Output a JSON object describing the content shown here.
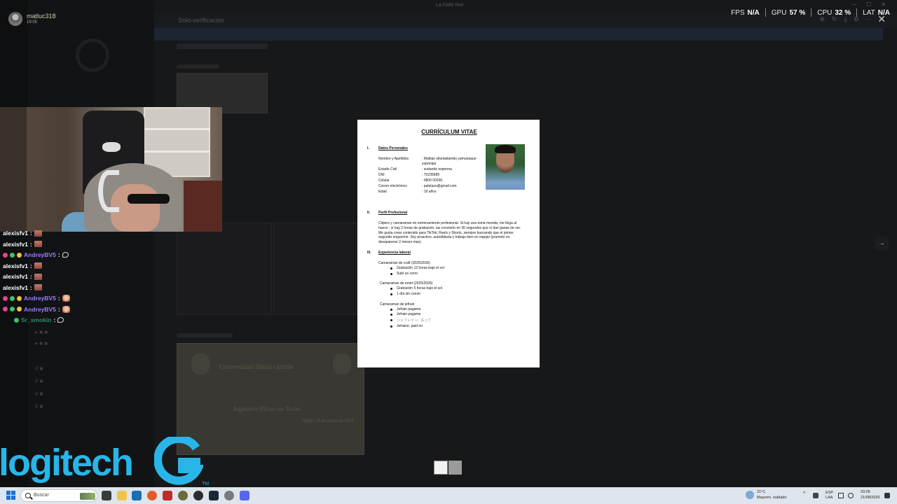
{
  "overlay": {
    "username": "matluc318",
    "stream_time": "19:05",
    "window_title": "La Dalle free",
    "stats": [
      {
        "label": "FPS",
        "value": "N/A"
      },
      {
        "label": "GPU",
        "value": "57 %"
      },
      {
        "label": "CPU",
        "value": "32 %"
      },
      {
        "label": "LAT",
        "value": "N/A"
      }
    ],
    "close_glyph": "✕",
    "next_glyph": "→"
  },
  "background": {
    "channel_title": "Solo-verificacion",
    "certificate_title": "Universidad illeral carrión",
    "certificate_subtitle": "Ingeniero Hiloso en Trolio",
    "certificate_date": "Negro 24 de Mayo de 2025"
  },
  "chat": {
    "messages": [
      {
        "user": "alexisfv1",
        "color": "#ffffff",
        "badges": [],
        "emote": "pepe"
      },
      {
        "user": "alexisfv1",
        "color": "#ffffff",
        "badges": [],
        "emote": "pepe"
      },
      {
        "user": "AndreyBV5",
        "color": "#9a7cff",
        "badges": [
          "#e0468a",
          "#3fbf6b",
          "#f0c040"
        ],
        "emote": "bubble"
      },
      {
        "user": "alexisfv1",
        "color": "#ffffff",
        "badges": [],
        "emote": "pepe"
      },
      {
        "user": "alexisfv1",
        "color": "#ffffff",
        "badges": [],
        "emote": "pepe"
      },
      {
        "user": "alexisfv1",
        "color": "#ffffff",
        "badges": [],
        "emote": "pepe"
      },
      {
        "user": "AndreyBV5",
        "color": "#9a7cff",
        "badges": [
          "#e0468a",
          "#3fbf6b",
          "#f0c040"
        ],
        "emote": "face"
      },
      {
        "user": "AndreyBV5",
        "color": "#9a7cff",
        "badges": [
          "#e0468a",
          "#3fbf6b",
          "#f0c040"
        ],
        "emote": "face"
      },
      {
        "user": "Sr_smokin",
        "color": "#2f8a6f",
        "badges": [
          "#3fbf6b"
        ],
        "emote": "bubble"
      }
    ]
  },
  "logo": {
    "text": "logitech",
    "tm": "TM"
  },
  "document": {
    "title": "CURRÍCULUM VITAE",
    "sections": [
      {
        "num": "I.",
        "title": "Datos Personales"
      },
      {
        "num": "II.",
        "title": "Perfil Profesional"
      },
      {
        "num": "III.",
        "title": "Experiencia laboral"
      }
    ],
    "personal": [
      {
        "key": "Nombre y Apellidos",
        "value": ": Mattias ollantaitambo yamunaque"
      },
      {
        "key": "",
        "value": "  yupanqui"
      },
      {
        "key": "Estado Civil",
        "value": ": sudando esperma"
      },
      {
        "key": "DNI",
        "value": ": 70235689"
      },
      {
        "key": "Celular",
        "value": ": 0800 00200."
      },
      {
        "key": "Correo electrónico",
        "value": ": paletazo@gmail.com"
      },
      {
        "key": "Edad",
        "value": ": 19 años"
      }
    ],
    "profile_text": "Clipero y camaraman en entrenamiento profesional. Si hay una toma movida, me llega al huevo ; si hay 2 horas de grabación, las convierto en 30 segundos que sí dan ganas de ver. Me gusta crear contenido para TikTok, Reels y Shorts, siempre buscando que el primer segundo enganche. Soy proactivo, autodidacta y trabajo bien en equipo (prometo no desaparecer 2 meses mas).",
    "jobs": [
      {
        "title": "Camaraman de craft (2025/2026)",
        "bullets": [
          "Grabación 12 horas bajo el sol",
          "Subí un cerro"
        ]
      },
      {
        "title": "Camaraman de emet (2025/2026)",
        "bullets": [
          "Grabación 5 horas bajo el sol",
          "1 día sin comer"
        ]
      },
      {
        "title": "Camaraman de jefrain",
        "bullets": [
          "Jefrain pagame",
          "Jefrain pagame",
          "ジェフレイン、払って",
          "Jefraine, paid mi"
        ]
      }
    ]
  },
  "taskbar": {
    "search_placeholder": "Buscar",
    "weather_temp": "21°C",
    "weather_desc": "Mayorm. nublado",
    "lang_1": "ESP",
    "lang_2": "LAA",
    "clock_time": "20:05",
    "clock_date": "21/08/2026"
  }
}
